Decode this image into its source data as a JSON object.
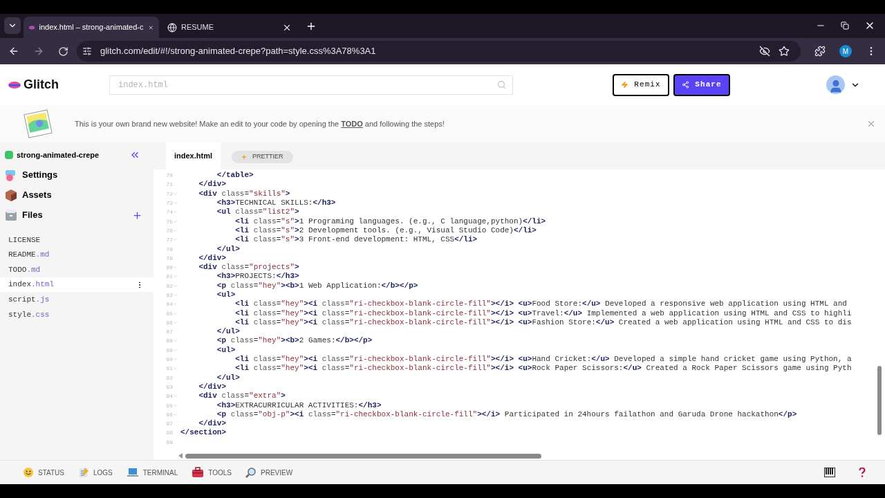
{
  "browser": {
    "tabs": [
      {
        "title": "index.html – strong-animated-c",
        "selected": true
      },
      {
        "title": "RESUME",
        "selected": false
      }
    ],
    "url": "glitch.com/edit/#!/strong-animated-crepe?path=style.css%3A78%3A1",
    "profile_initial": "M"
  },
  "header": {
    "logo": "Glitch",
    "search": {
      "placeholder": "index.html"
    },
    "buttons": [
      {
        "kind": "remix",
        "label": "Remix"
      },
      {
        "kind": "share",
        "label": "Share"
      }
    ]
  },
  "banner": {
    "before": "This is your own brand new website! Make an edit to your code by opening the ",
    "link": "TODO",
    "after": " and following the steps!"
  },
  "sidebar": {
    "project": "strong-animated-crepe",
    "sections": [
      {
        "kind": "settings",
        "label": "Settings"
      },
      {
        "kind": "assets",
        "label": "Assets"
      },
      {
        "kind": "files",
        "label": "Files"
      }
    ],
    "files": [
      {
        "name": "LICENSE",
        "selected": false
      },
      {
        "name": "README",
        "ext": ".md",
        "selected": false
      },
      {
        "name": "TODO",
        "ext": ".md",
        "selected": false
      },
      {
        "name": "index",
        "ext": ".html",
        "selected": true
      },
      {
        "name": "script",
        "ext": ".js",
        "selected": false
      },
      {
        "name": "style",
        "ext": ".css",
        "selected": false
      }
    ]
  },
  "editor": {
    "tab": "index.html",
    "prettier": "PRETTIER",
    "lines": [
      {
        "n": "70",
        "foldable": false,
        "code": "        </table>"
      },
      {
        "n": "71",
        "foldable": false,
        "code": "    </div>"
      },
      {
        "n": "72",
        "foldable": true,
        "code": "    <div class=\"skills\">"
      },
      {
        "n": "73",
        "foldable": true,
        "code": "        <h3>TECHNICAL SKILLS:</h3>"
      },
      {
        "n": "74",
        "foldable": true,
        "code": "        <ul class=\"list2\">"
      },
      {
        "n": "75",
        "foldable": true,
        "code": "            <li class=\"s\">1 Programing languages. (e.g., C language,python)</li>"
      },
      {
        "n": "76",
        "foldable": true,
        "code": "            <li class=\"s\">2 Development tools. (e.g., Visual Studio Code)</li>"
      },
      {
        "n": "77",
        "foldable": true,
        "code": "            <li class=\"s\">3 Front-end development: HTML, CSS</li>"
      },
      {
        "n": "78",
        "foldable": false,
        "code": "        </ul>"
      },
      {
        "n": "79",
        "foldable": false,
        "code": "    </div>"
      },
      {
        "n": "80",
        "foldable": true,
        "code": "    <div class=\"projects\">"
      },
      {
        "n": "81",
        "foldable": true,
        "code": "        <h3>PROJECTS:</h3>"
      },
      {
        "n": "82",
        "foldable": true,
        "code": "        <p class=\"hey\"><b>1 Web Application:</b></p>"
      },
      {
        "n": "83",
        "foldable": true,
        "code": "        <ul>"
      },
      {
        "n": "84",
        "foldable": true,
        "code": "            <li class=\"hey\"><i class=\"ri-checkbox-blank-circle-fill\"></i> <u>Food Store:</u> Developed a responsive web application using HTML and"
      },
      {
        "n": "85",
        "foldable": true,
        "code": "            <li class=\"hey\"><i class=\"ri-checkbox-blank-circle-fill\"></i> <u>Travel:</u> Implemented a web application using HTML and CSS to highli"
      },
      {
        "n": "86",
        "foldable": true,
        "code": "            <li class=\"hey\"><i class=\"ri-checkbox-blank-circle-fill\"></i> <u>Fashion Store:</u> Created a web application using HTML and CSS to dis"
      },
      {
        "n": "87",
        "foldable": false,
        "code": "        </ul>"
      },
      {
        "n": "88",
        "foldable": true,
        "code": "        <p class=\"hey\"><b>2 Games:</b></p>"
      },
      {
        "n": "89",
        "foldable": true,
        "code": "        <ul>"
      },
      {
        "n": "90",
        "foldable": true,
        "code": "            <li class=\"hey\"><i class=\"ri-checkbox-blank-circle-fill\"></i> <u>Hand Cricket:</u> Developed a simple hand cricket game using Python, a"
      },
      {
        "n": "91",
        "foldable": true,
        "code": "            <li class=\"hey\"><i class=\"ri-checkbox-blank-circle-fill\"></i> <u>Rock Paper Scissors:</u> Created a Rock Paper Scissors game using Pyth"
      },
      {
        "n": "92",
        "foldable": false,
        "code": "        </ul>"
      },
      {
        "n": "93",
        "foldable": false,
        "code": "    </div>"
      },
      {
        "n": "94",
        "foldable": true,
        "code": "    <div class=\"extra\">"
      },
      {
        "n": "95",
        "foldable": true,
        "code": "        <h3>EXTRACURRICULAR ACTIVITIES:</h3>"
      },
      {
        "n": "96",
        "foldable": true,
        "code": "        <p class=\"obj-p\"><i class=\"ri-checkbox-blank-circle-fill\"></i> Participated in 24hours failathon and Garuda Drone hackathon</p>"
      },
      {
        "n": "97",
        "foldable": false,
        "code": "    </div>"
      },
      {
        "n": "98",
        "foldable": false,
        "code": "</section>"
      },
      {
        "n": "99",
        "foldable": false
      }
    ]
  },
  "bottom_bar": [
    {
      "kind": "status",
      "label": "STATUS"
    },
    {
      "kind": "logs",
      "label": "LOGS"
    },
    {
      "kind": "terminal",
      "label": "TERMINAL"
    },
    {
      "kind": "tools",
      "label": "TOOLS"
    },
    {
      "kind": "preview",
      "label": "PREVIEW"
    }
  ]
}
